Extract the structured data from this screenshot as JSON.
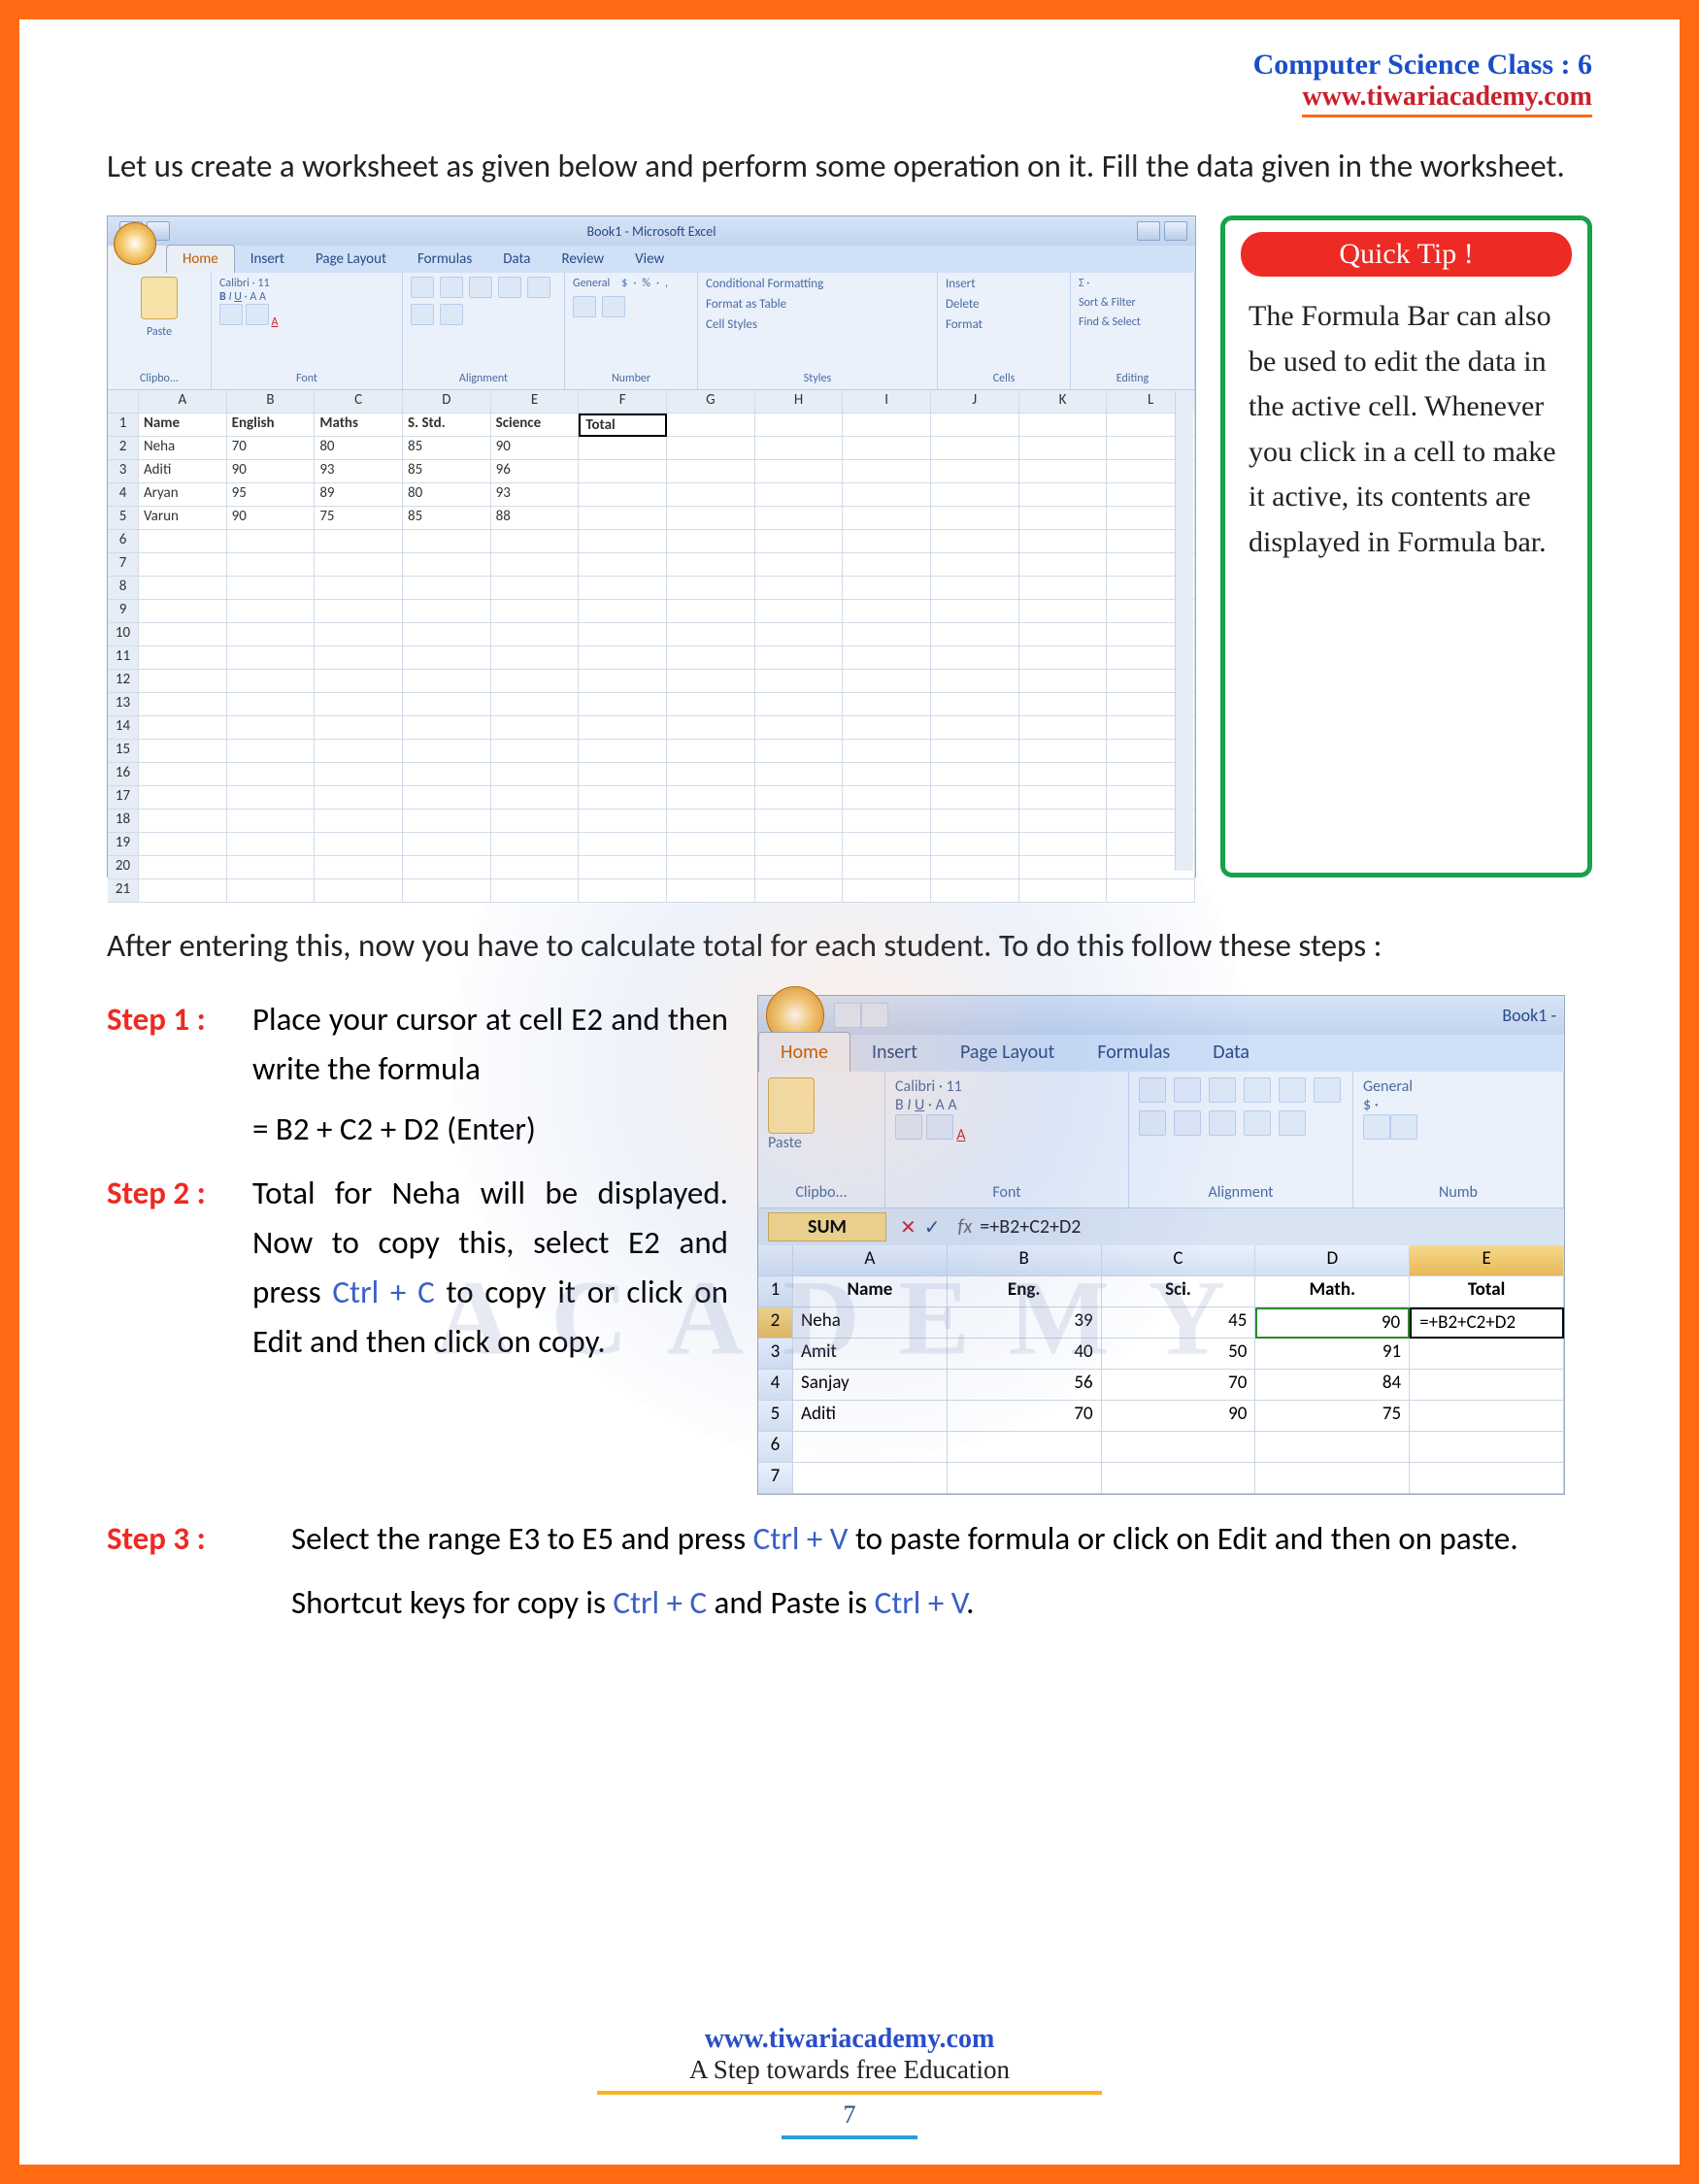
{
  "header": {
    "title": "Computer Science Class : 6",
    "link": "www.tiwariacademy.com"
  },
  "intro": "Let us create a worksheet as given below and perform some operation on it. Fill the data given in the worksheet.",
  "excel1": {
    "title": "Book1 - Microsoft Excel",
    "tabs": [
      "Home",
      "Insert",
      "Page Layout",
      "Formulas",
      "Data",
      "Review",
      "View"
    ],
    "active_tab": "Home",
    "ribbon_groups": [
      "Clipbo...",
      "Font",
      "Alignment",
      "Number",
      "Styles",
      "Cells",
      "Editing"
    ],
    "paste_label": "Paste",
    "font_name": "Calibri",
    "font_size": "11",
    "number_group": "General",
    "styles": {
      "cf": "Conditional Formatting",
      "fat": "Format as Table",
      "cs": "Cell Styles"
    },
    "cells_group": {
      "ins": "Insert",
      "del": "Delete",
      "fmt": "Format"
    },
    "editing_group": {
      "sort": "Sort & Filter",
      "find": "Find & Select"
    },
    "columns": [
      "A",
      "B",
      "C",
      "D",
      "E",
      "F",
      "G",
      "H",
      "I",
      "J",
      "K",
      "L"
    ],
    "headers": [
      "Name",
      "English",
      "Maths",
      "S. Std.",
      "Science",
      "Total"
    ],
    "rows": [
      [
        "Neha",
        "70",
        "80",
        "85",
        "90",
        ""
      ],
      [
        "Aditi",
        "90",
        "93",
        "85",
        "96",
        ""
      ],
      [
        "Aryan",
        "95",
        "89",
        "80",
        "93",
        ""
      ],
      [
        "Varun",
        "90",
        "75",
        "85",
        "88",
        ""
      ]
    ],
    "visible_rows": 21
  },
  "tip": {
    "head": "Quick Tip !",
    "text": "The Formula Bar can also be used to edit the data in the active cell. Whenever you click in a cell to make it active, its contents are displayed in Formula bar."
  },
  "mid": "After entering this, now you have to calculate total for each student.  To do this follow these steps :",
  "step1": {
    "label": "Step 1 :",
    "body": "Place your cursor at cell E2 and then write the formula",
    "formula": "= B2 + C2 + D2 (Enter)"
  },
  "step2": {
    "label": "Step 2 :",
    "body_pre": "Total for Neha will be displayed. Now to copy this, select E2 and press ",
    "ctrl_c": "Ctrl + C",
    "body_post": " to copy it or click on Edit and then click on copy."
  },
  "step3": {
    "label": "Step 3 :",
    "body_pre": "Select the range E3 to E5 and press  ",
    "ctrl_v": "Ctrl + V",
    "body_post": " to paste formula or click on Edit and then on paste."
  },
  "shortcuts": {
    "pre": "Shortcut keys for copy is ",
    "c": "Ctrl + C",
    "mid": " and Paste is ",
    "v": "Ctrl + V",
    "post": "."
  },
  "excel2": {
    "title": "Book1 -",
    "tabs": [
      "Home",
      "Insert",
      "Page Layout",
      "Formulas",
      "Data"
    ],
    "active_tab": "Home",
    "ribbon_groups": [
      "Clipbo...",
      "Font",
      "Alignment",
      "Numb"
    ],
    "paste_label": "Paste",
    "font_name": "Calibri",
    "font_size": "11",
    "number_group": "General",
    "namebox": "SUM",
    "fbar": "=+B2+C2+D2",
    "columns": [
      "A",
      "B",
      "C",
      "D",
      "E"
    ],
    "headers": [
      "Name",
      "Eng.",
      "Sci.",
      "Math.",
      "Total"
    ],
    "rows": [
      [
        "Neha",
        "39",
        "45",
        "90",
        "=+B2+C2+D2"
      ],
      [
        "Amit",
        "40",
        "50",
        "91",
        ""
      ],
      [
        "Sanjay",
        "56",
        "70",
        "84",
        ""
      ],
      [
        "Aditi",
        "70",
        "90",
        "75",
        ""
      ]
    ],
    "visible_rows": 7
  },
  "footer": {
    "link": "www.tiwariacademy.com",
    "tag": "A Step towards free Education",
    "page": "7"
  },
  "watermark": "ACADEMY"
}
